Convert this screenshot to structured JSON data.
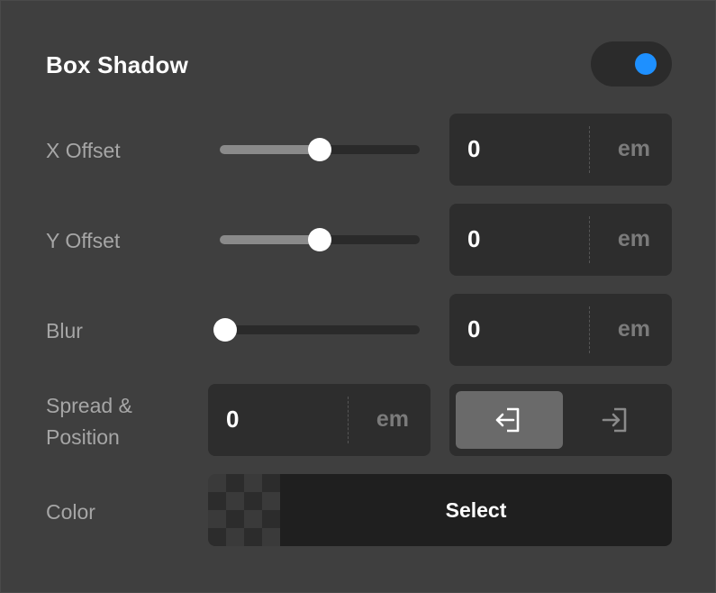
{
  "panel": {
    "title": "Box Shadow",
    "enabled": true,
    "accent_color": "#1e90ff"
  },
  "x_offset": {
    "label": "X Offset",
    "slider_fraction": 0.5,
    "value": "0",
    "unit": "em"
  },
  "y_offset": {
    "label": "Y Offset",
    "slider_fraction": 0.5,
    "value": "0",
    "unit": "em"
  },
  "blur": {
    "label": "Blur",
    "slider_fraction": 0.0,
    "value": "0",
    "unit": "em"
  },
  "spread_position": {
    "label_line1": "Spread &",
    "label_line2": "Position",
    "value": "0",
    "unit": "em",
    "position_options": [
      {
        "icon": "inset-arrow-icon",
        "selected": true
      },
      {
        "icon": "outset-arrow-icon",
        "selected": false
      }
    ]
  },
  "color": {
    "label": "Color",
    "button_label": "Select"
  }
}
